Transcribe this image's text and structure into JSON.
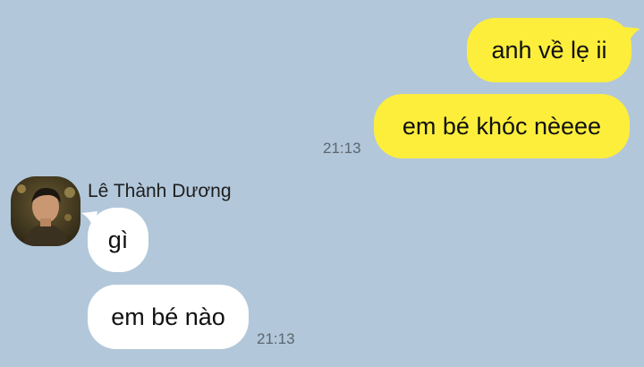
{
  "chat": {
    "outgoing": [
      {
        "text": "anh về lẹ ii"
      },
      {
        "text": "em bé khóc nèeee",
        "time": "21:13"
      }
    ],
    "contact": {
      "name": "Lê Thành Dương",
      "avatar_icon": "contact-photo"
    },
    "incoming": [
      {
        "text": "gì"
      },
      {
        "text": "em bé nào",
        "time": "21:13"
      }
    ]
  },
  "colors": {
    "background": "#b2c7da",
    "outgoing_bubble": "#fdee3c",
    "incoming_bubble": "#ffffff",
    "timestamp": "#5b6670"
  }
}
